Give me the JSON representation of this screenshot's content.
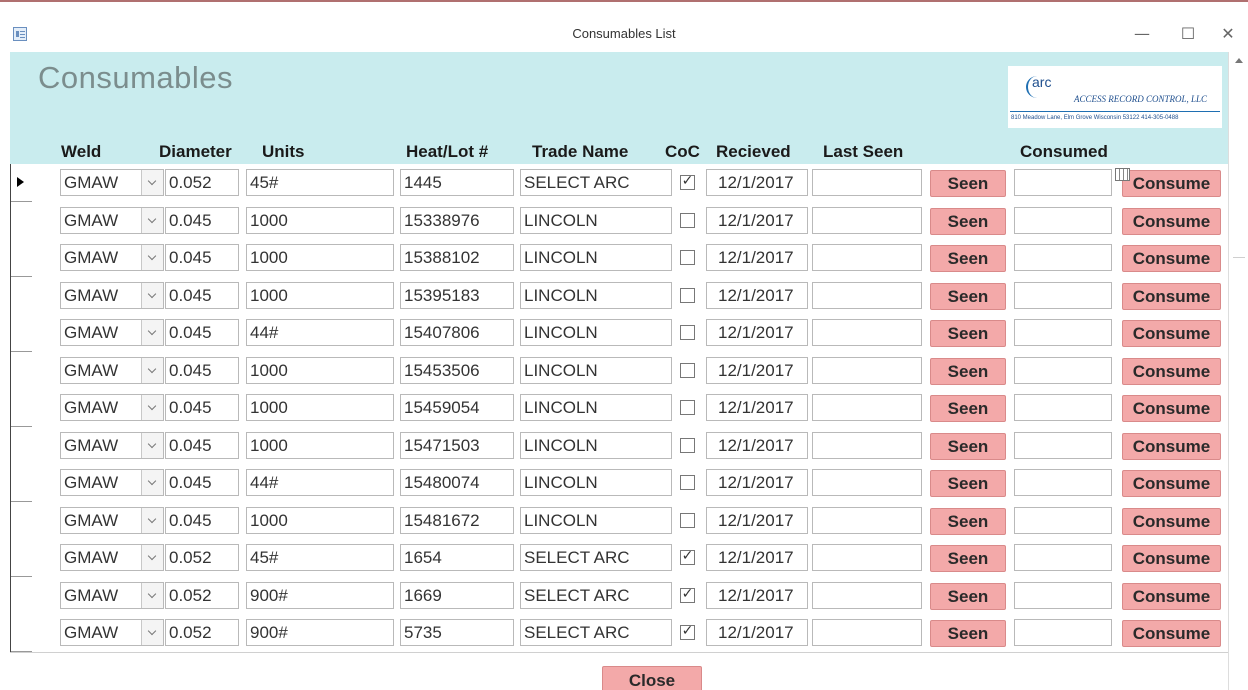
{
  "window": {
    "title": "Consumables List",
    "minimize_glyph": "—",
    "maximize_glyph": "☐",
    "close_glyph": "✕"
  },
  "header": {
    "form_title": "Consumables",
    "logo": {
      "mark_text": "arc",
      "company": "ACCESS RECORD CONTROL, LLC",
      "address": "810 Meadow Lane, Elm Grove Wisconsin  53122  414-305-0488"
    },
    "columns": {
      "weld": "Weld",
      "diameter": "Diameter",
      "units": "Units",
      "heat_lot": "Heat/Lot #",
      "trade_name": "Trade Name",
      "coc": "CoC",
      "received": "Recieved",
      "last_seen": "Last Seen",
      "consumed": "Consumed"
    }
  },
  "rows": [
    {
      "weld": "GMAW",
      "diameter": "0.052",
      "units": "45#",
      "heat_lot": "1445",
      "trade_name": "SELECT ARC",
      "coc": true,
      "received": "12/1/2017",
      "last_seen": "",
      "consumed": "",
      "seen_label": "Seen",
      "consume_label": "Consume"
    },
    {
      "weld": "GMAW",
      "diameter": "0.045",
      "units": "1000",
      "heat_lot": "15338976",
      "trade_name": "LINCOLN",
      "coc": false,
      "received": "12/1/2017",
      "last_seen": "",
      "consumed": "",
      "seen_label": "Seen",
      "consume_label": "Consume"
    },
    {
      "weld": "GMAW",
      "diameter": "0.045",
      "units": "1000",
      "heat_lot": "15388102",
      "trade_name": "LINCOLN",
      "coc": false,
      "received": "12/1/2017",
      "last_seen": "",
      "consumed": "",
      "seen_label": "Seen",
      "consume_label": "Consume"
    },
    {
      "weld": "GMAW",
      "diameter": "0.045",
      "units": "1000",
      "heat_lot": "15395183",
      "trade_name": "LINCOLN",
      "coc": false,
      "received": "12/1/2017",
      "last_seen": "",
      "consumed": "",
      "seen_label": "Seen",
      "consume_label": "Consume"
    },
    {
      "weld": "GMAW",
      "diameter": "0.045",
      "units": "44#",
      "heat_lot": "15407806",
      "trade_name": "LINCOLN",
      "coc": false,
      "received": "12/1/2017",
      "last_seen": "",
      "consumed": "",
      "seen_label": "Seen",
      "consume_label": "Consume"
    },
    {
      "weld": "GMAW",
      "diameter": "0.045",
      "units": "1000",
      "heat_lot": "15453506",
      "trade_name": "LINCOLN",
      "coc": false,
      "received": "12/1/2017",
      "last_seen": "",
      "consumed": "",
      "seen_label": "Seen",
      "consume_label": "Consume"
    },
    {
      "weld": "GMAW",
      "diameter": "0.045",
      "units": "1000",
      "heat_lot": "15459054",
      "trade_name": "LINCOLN",
      "coc": false,
      "received": "12/1/2017",
      "last_seen": "",
      "consumed": "",
      "seen_label": "Seen",
      "consume_label": "Consume"
    },
    {
      "weld": "GMAW",
      "diameter": "0.045",
      "units": "1000",
      "heat_lot": "15471503",
      "trade_name": "LINCOLN",
      "coc": false,
      "received": "12/1/2017",
      "last_seen": "",
      "consumed": "",
      "seen_label": "Seen",
      "consume_label": "Consume"
    },
    {
      "weld": "GMAW",
      "diameter": "0.045",
      "units": "44#",
      "heat_lot": "15480074",
      "trade_name": "LINCOLN",
      "coc": false,
      "received": "12/1/2017",
      "last_seen": "",
      "consumed": "",
      "seen_label": "Seen",
      "consume_label": "Consume"
    },
    {
      "weld": "GMAW",
      "diameter": "0.045",
      "units": "1000",
      "heat_lot": "15481672",
      "trade_name": "LINCOLN",
      "coc": false,
      "received": "12/1/2017",
      "last_seen": "",
      "consumed": "",
      "seen_label": "Seen",
      "consume_label": "Consume"
    },
    {
      "weld": "GMAW",
      "diameter": "0.052",
      "units": "45#",
      "heat_lot": "1654",
      "trade_name": "SELECT ARC",
      "coc": true,
      "received": "12/1/2017",
      "last_seen": "",
      "consumed": "",
      "seen_label": "Seen",
      "consume_label": "Consume"
    },
    {
      "weld": "GMAW",
      "diameter": "0.052",
      "units": "900#",
      "heat_lot": "1669",
      "trade_name": "SELECT ARC",
      "coc": true,
      "received": "12/1/2017",
      "last_seen": "",
      "consumed": "",
      "seen_label": "Seen",
      "consume_label": "Consume"
    },
    {
      "weld": "GMAW",
      "diameter": "0.052",
      "units": "900#",
      "heat_lot": "5735",
      "trade_name": "SELECT ARC",
      "coc": true,
      "received": "12/1/2017",
      "last_seen": "",
      "consumed": "",
      "seen_label": "Seen",
      "consume_label": "Consume"
    }
  ],
  "current_record": 1,
  "icons": {
    "app": "form-view-icon",
    "dropdown": "chevron-down-icon",
    "calendar": "calendar-icon",
    "checkmark": "✓"
  },
  "footer": {
    "close_label": "Close"
  },
  "colors": {
    "header_bg": "#c9ecee",
    "button_bg": "#f3a9a9",
    "title_color": "#7b8d8d"
  }
}
